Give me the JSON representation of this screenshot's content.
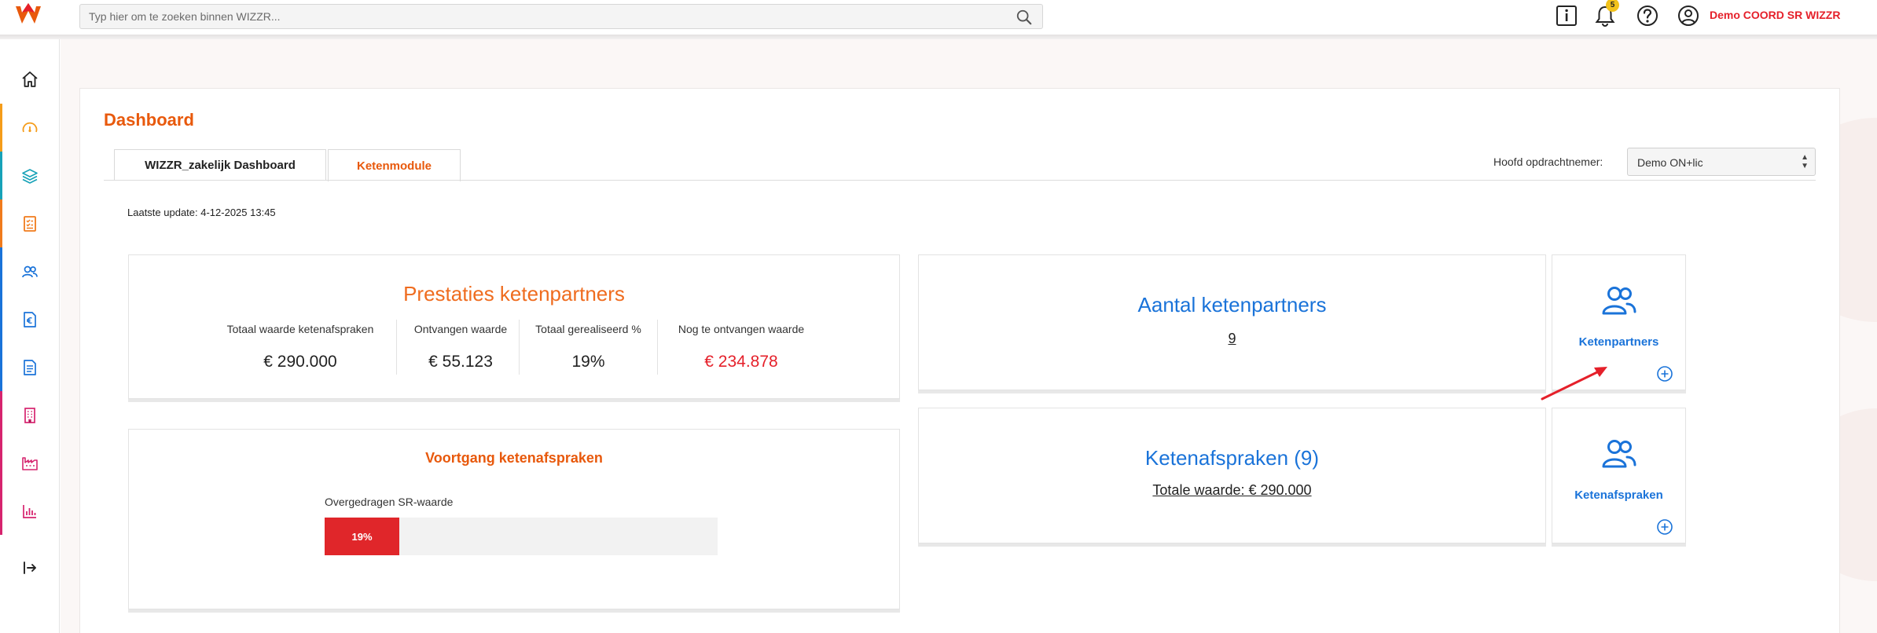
{
  "topbar": {
    "search_placeholder": "Typ hier om te zoeken binnen WIZZR...",
    "notification_count": "5",
    "user_name": "Demo COORD SR WIZZR",
    "icons": [
      "info-icon",
      "bell-icon",
      "help-icon",
      "user-circle-icon",
      "search-icon"
    ]
  },
  "sidebar": {
    "items": [
      {
        "icon": "home-icon",
        "color": "#222222"
      },
      {
        "icon": "gauge-icon",
        "color": "#f59c1a"
      },
      {
        "icon": "layers-icon",
        "color": "#17a2b8"
      },
      {
        "icon": "checklist-icon",
        "color": "#f07b1c"
      },
      {
        "icon": "users-icon",
        "color": "#1a73d9"
      },
      {
        "icon": "euro-document-icon",
        "color": "#1a73d9"
      },
      {
        "icon": "document-icon",
        "color": "#1a73d9"
      },
      {
        "icon": "building-icon",
        "color": "#d6246e"
      },
      {
        "icon": "factory-icon",
        "color": "#d6246e"
      },
      {
        "icon": "bar-chart-icon",
        "color": "#d6246e"
      },
      {
        "icon": "logout-icon",
        "color": "#222222"
      }
    ]
  },
  "page": {
    "title": "Dashboard",
    "tabs": [
      {
        "label": "WIZZR_zakelijk Dashboard",
        "active": false
      },
      {
        "label": "Ketenmodule",
        "active": true
      }
    ],
    "filter_label": "Hoofd opdrachtnemer:",
    "filter_value": "Demo ON+lic",
    "last_update": "Laatste update: 4-12-2025 13:45"
  },
  "performance": {
    "title": "Prestaties ketenpartners",
    "stats": [
      {
        "label": "Totaal waarde ketenafspraken",
        "value": "€ 290.000"
      },
      {
        "label": "Ontvangen waarde",
        "value": "€ 55.123"
      },
      {
        "label": "Totaal gerealiseerd %",
        "value": "19%"
      },
      {
        "label": "Nog te ontvangen waarde",
        "value": "€ 234.878"
      }
    ]
  },
  "progress": {
    "title": "Voortgang ketenafspraken",
    "bar_label": "Overgedragen SR-waarde",
    "percent_text": "19%",
    "percent": 19
  },
  "partners": {
    "title": "Aantal ketenpartners",
    "count": "9",
    "tile_label": "Ketenpartners"
  },
  "agreements": {
    "title": "Ketenafspraken (9)",
    "total": "Totale waarde: € 290.000",
    "tile_label": "Ketenafspraken"
  },
  "colors": {
    "accent_orange": "#e8590c",
    "accent_blue": "#1a73d9",
    "alert_red": "#e5202a"
  }
}
